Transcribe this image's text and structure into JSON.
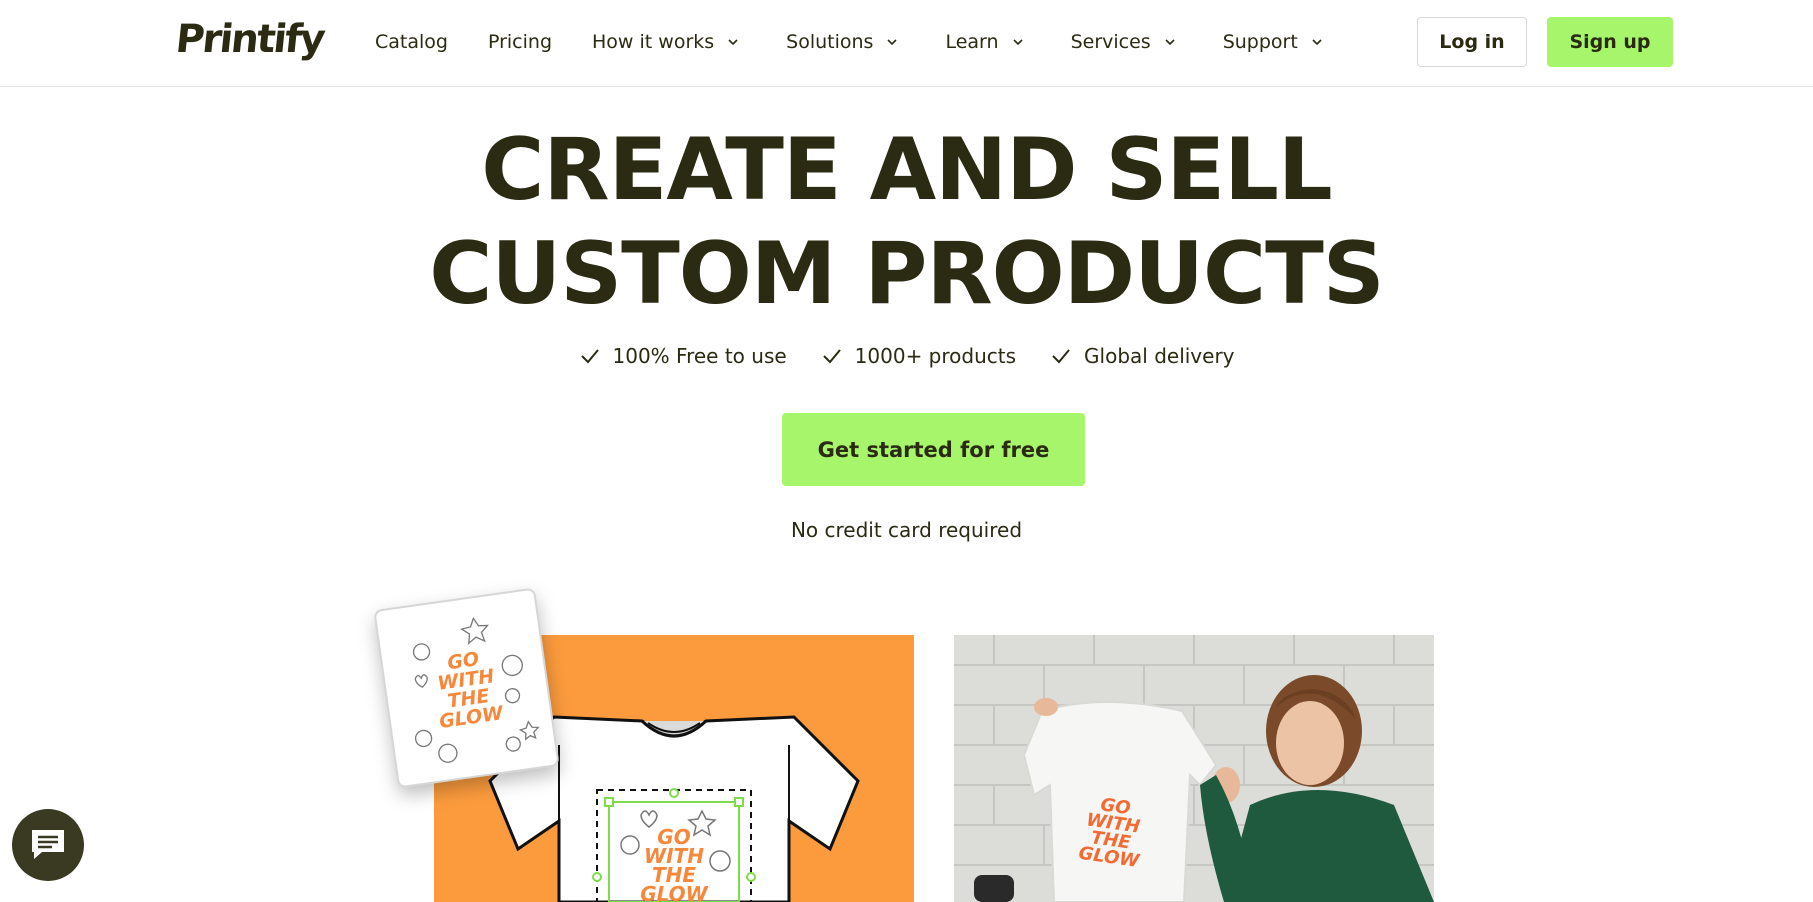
{
  "header": {
    "logo": "Printify",
    "nav": [
      {
        "label": "Catalog",
        "dropdown": false
      },
      {
        "label": "Pricing",
        "dropdown": false
      },
      {
        "label": "How it works",
        "dropdown": true
      },
      {
        "label": "Solutions",
        "dropdown": true
      },
      {
        "label": "Learn",
        "dropdown": true
      },
      {
        "label": "Services",
        "dropdown": true
      },
      {
        "label": "Support",
        "dropdown": true
      }
    ],
    "login_label": "Log in",
    "signup_label": "Sign up"
  },
  "hero": {
    "title_line1": "CREATE AND SELL",
    "title_line2": "CUSTOM PRODUCTS",
    "features": [
      "100% Free to use",
      "1000+ products",
      "Global delivery"
    ],
    "cta_label": "Get started for free",
    "note": "No credit card required"
  },
  "artwork": {
    "design_text": [
      "GO",
      "WITH",
      "THE",
      "GLOW"
    ]
  },
  "colors": {
    "accent": "#a6f56b",
    "text": "#2b2a12",
    "orange": "#fb9b3d",
    "design": "#f7873a"
  },
  "icons": {
    "chat": "chat-bubble-icon",
    "check": "check-icon",
    "chevron": "chevron-down-icon"
  }
}
